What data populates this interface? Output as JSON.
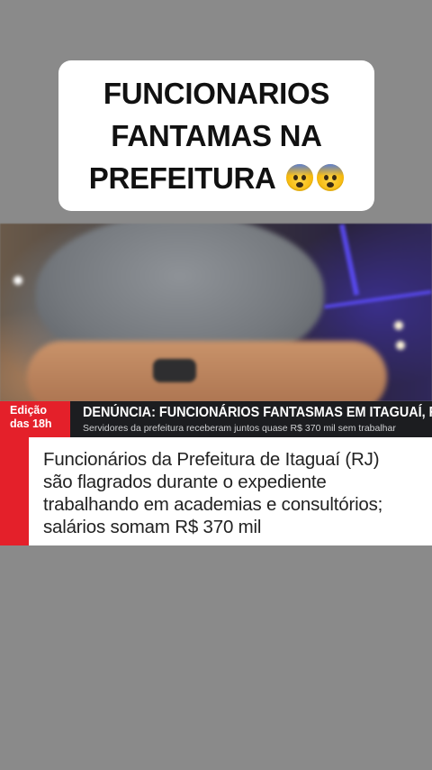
{
  "caption": {
    "lines": [
      "FUNCIONARIOS",
      "FANTAMAS NA",
      "PREFEITURA"
    ],
    "emoji_names": [
      "fearful-face-emoji",
      "fearful-face-emoji"
    ]
  },
  "broadcast": {
    "edition_label": "Edição",
    "edition_time": "das 18h",
    "headline": "DENÚNCIA: FUNCIONÁRIOS FANTASMAS EM ITAGUAÍ, RJ",
    "subline": "Servidores da prefeitura receberam juntos quase R$ 370 mil sem trabalhar"
  },
  "story": {
    "lines": [
      "Funcionários da Prefeitura de Itaguaí (RJ)",
      "são flagrados durante o expediente",
      "trabalhando em academias e consultórios;",
      "salários somam R$ 370 mil"
    ]
  },
  "colors": {
    "background": "#8a8a8a",
    "accent_red": "#e4202a",
    "ticker_dark": "#1c1d20"
  }
}
